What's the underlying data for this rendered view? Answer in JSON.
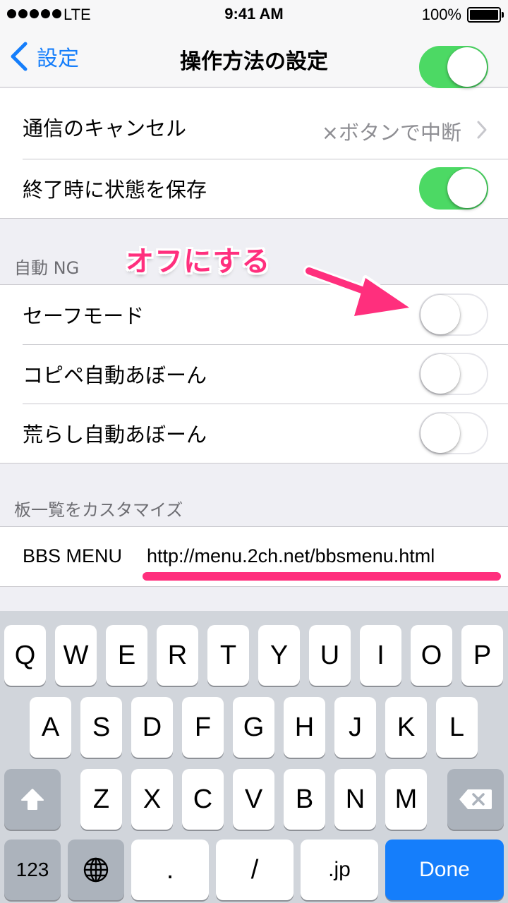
{
  "status_bar": {
    "carrier": "LTE",
    "time": "9:41 AM",
    "battery": "100%"
  },
  "nav": {
    "back_label": "設定",
    "title": "操作方法の設定"
  },
  "group1": {
    "cancel": {
      "label": "通信のキャンセル",
      "value": "×ボタンで中断"
    },
    "save_state": {
      "label": "終了時に状態を保存",
      "on": true
    }
  },
  "auto_ng": {
    "header": "自動 NG",
    "items": [
      {
        "label": "セーフモード",
        "on": false
      },
      {
        "label": "コピペ自動あぼーん",
        "on": false
      },
      {
        "label": "荒らし自動あぼーん",
        "on": false
      }
    ]
  },
  "board_list": {
    "header": "板一覧をカスタマイズ",
    "bbs_menu_label": "BBS MENU",
    "bbs_menu_url": "http://menu.2ch.net/bbsmenu.html"
  },
  "annotation": {
    "callout": "オフにする"
  },
  "keyboard": {
    "row1": [
      "Q",
      "W",
      "E",
      "R",
      "T",
      "Y",
      "U",
      "I",
      "O",
      "P"
    ],
    "row2": [
      "A",
      "S",
      "D",
      "F",
      "G",
      "H",
      "J",
      "K",
      "L"
    ],
    "row3": [
      "Z",
      "X",
      "C",
      "V",
      "B",
      "N",
      "M"
    ],
    "numbers_label": "123",
    "dot_label": ".",
    "slash_label": "/",
    "jp_label": ".jp",
    "done_label": "Done"
  },
  "colors": {
    "accent": "#157efb",
    "toggle_on": "#4cd964",
    "annotation": "#ff2f7d"
  }
}
